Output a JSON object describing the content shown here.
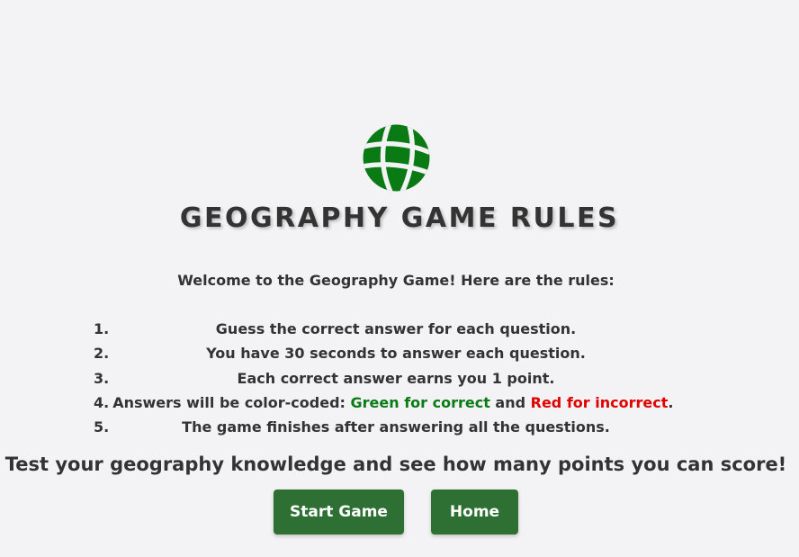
{
  "logo": {
    "icon": "globe-icon",
    "color": "#0a7a15"
  },
  "title": "GEOGRAPHY GAME RULES",
  "welcome": "Welcome to the Geography Game! Here are the rules:",
  "rules": [
    {
      "number": "1.",
      "text": "Guess the correct answer for each question."
    },
    {
      "number": "2.",
      "text": "You have 30 seconds to answer each question."
    },
    {
      "number": "3.",
      "text": "Each correct answer earns you 1 point."
    },
    {
      "number": "4.",
      "prefix": "Answers will be color-coded: ",
      "green_text": "Green for correct",
      "middle": " and ",
      "red_text": "Red for incorrect",
      "suffix": "."
    },
    {
      "number": "5.",
      "text": "The game finishes after answering all the questions."
    }
  ],
  "tagline": "Test your geography knowledge and see how many points you can score!",
  "buttons": {
    "start": "Start Game",
    "home": "Home"
  },
  "colors": {
    "accent": "#2e7033",
    "correct": "#0a7a15",
    "incorrect": "#e00000",
    "background": "#f3f3f5"
  }
}
